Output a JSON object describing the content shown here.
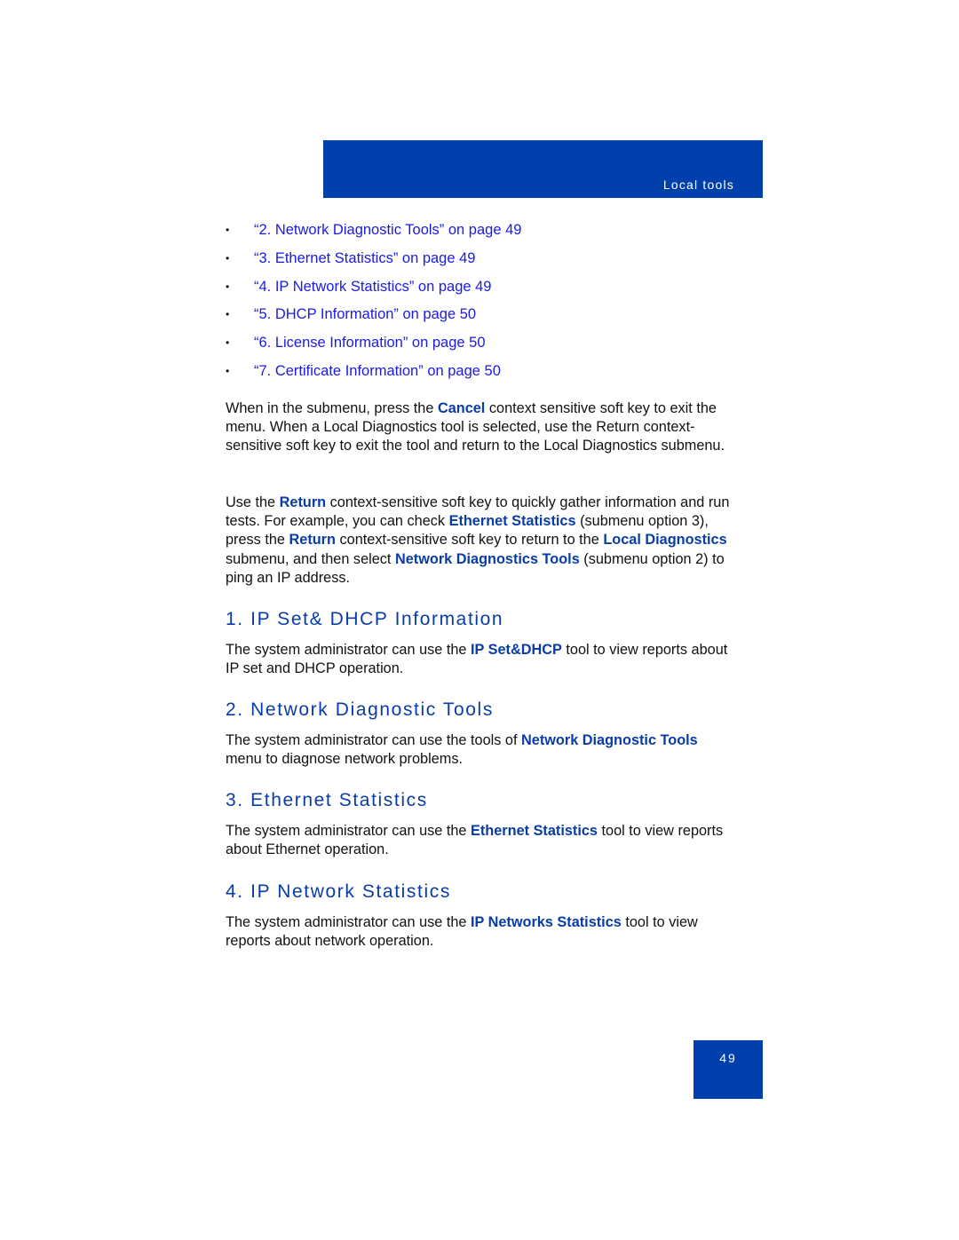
{
  "header": {
    "section_label": "Local tools",
    "bar_color": "#0040ad"
  },
  "toc": [
    {
      "bullet": "•",
      "text": "“2. Network Diagnostic Tools” on page 49"
    },
    {
      "bullet": "•",
      "text": "“3. Ethernet Statistics” on page 49"
    },
    {
      "bullet": "•",
      "text": "“4. IP Network Statistics” on page 49"
    },
    {
      "bullet": "•",
      "text": "“5. DHCP Information” on page 50"
    },
    {
      "bullet": "•",
      "text": "“6. License Information” on page 50"
    },
    {
      "bullet": "•",
      "text": "“7. Certificate Information” on page 50"
    }
  ],
  "intro": {
    "p1": {
      "a": "When in the submenu, press the ",
      "b": "Cancel",
      "c": " context sensitive soft key to exit the menu. When a Local Diagnostics tool is selected, use the Return context-sensitive soft key to exit the tool and return to the Local Diagnostics submenu."
    },
    "p2": {
      "a": "Use the ",
      "b": "Return",
      "c": " context-sensitive soft key to quickly gather information and run tests. For example, you can check ",
      "d": "Ethernet Statistics",
      "e": " (submenu option 3), press the ",
      "f": "Return",
      "g": " context-sensitive soft key to return to the ",
      "h": "Local Diagnostics",
      "i": " submenu, and then select ",
      "j": "Network Diagnostics Tools",
      "k": " (submenu option 2) to ping an IP address."
    }
  },
  "sections": [
    {
      "heading": "1. IP Set& DHCP Information",
      "a": "The system administrator can use the ",
      "b": "IP Set&DHCP",
      "c": " tool to view reports about IP set and DHCP operation."
    },
    {
      "heading": "2. Network Diagnostic Tools",
      "a": "The system administrator can use the tools of ",
      "b": "Network Diagnostic Tools",
      "c": " menu to diagnose network problems."
    },
    {
      "heading": "3. Ethernet Statistics",
      "a": "The system administrator can use the ",
      "b": "Ethernet Statistics",
      "c": " tool to view reports about Ethernet operation."
    },
    {
      "heading": "4. IP Network Statistics",
      "a": "The system administrator can use the ",
      "b": "IP Networks Statistics",
      "c": " tool to view reports about network operation."
    }
  ],
  "footer": {
    "page_number": "49"
  }
}
